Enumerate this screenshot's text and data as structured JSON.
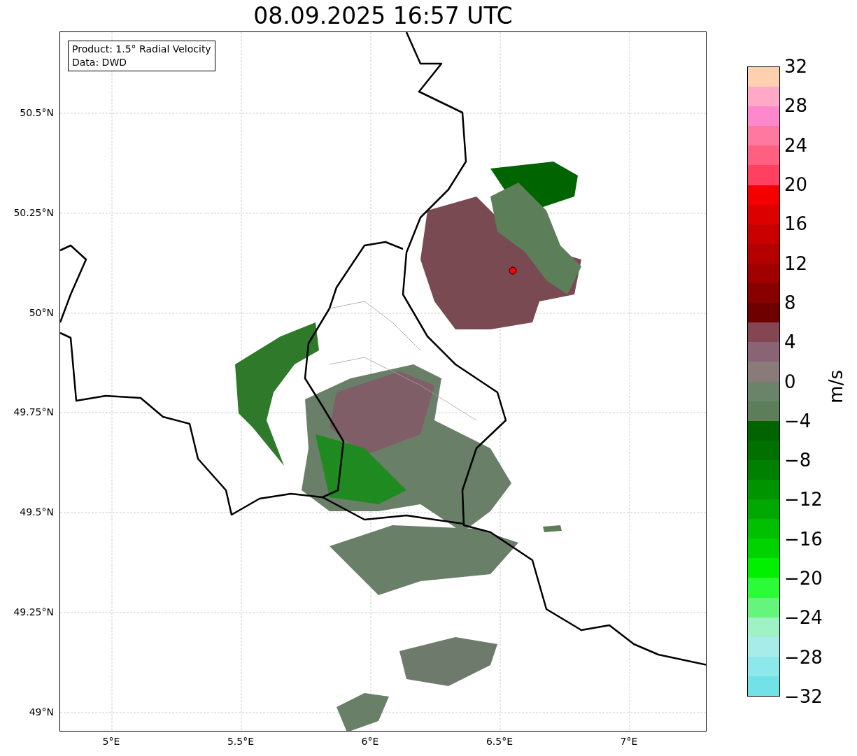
{
  "title": "08.09.2025 16:57 UTC",
  "legend": [
    "Product: 1.5° Radial Velocity",
    "Data: DWD"
  ],
  "map": {
    "y_ticks": [
      "50.5°N",
      "50.25°N",
      "50°N",
      "49.75°N",
      "49.5°N",
      "49.25°N",
      "49°N"
    ],
    "x_ticks": [
      "5°E",
      "5.5°E",
      "6°E",
      "6.5°E",
      "7°E"
    ]
  },
  "colorbar": {
    "label": "m/s",
    "ticks": [
      "32",
      "28",
      "24",
      "20",
      "16",
      "12",
      "8",
      "4",
      "0",
      "−4",
      "−8",
      "−12",
      "−16",
      "−20",
      "−24",
      "−28",
      "−32"
    ],
    "segments": [
      {
        "color": "#72e2e6"
      },
      {
        "color": "#8ce8ea"
      },
      {
        "color": "#a8ecea"
      },
      {
        "color": "#9ef2c6"
      },
      {
        "color": "#66f57c"
      },
      {
        "color": "#2cfc38"
      },
      {
        "color": "#00f000"
      },
      {
        "color": "#00d400"
      },
      {
        "color": "#00c000"
      },
      {
        "color": "#00a800"
      },
      {
        "color": "#009400"
      },
      {
        "color": "#008000"
      },
      {
        "color": "#007000"
      },
      {
        "color": "#006400"
      },
      {
        "color": "#5c7e58"
      },
      {
        "color": "#6a846a"
      },
      {
        "color": "#8a7a7a"
      },
      {
        "color": "#8a6474"
      },
      {
        "color": "#844650"
      },
      {
        "color": "#6e0000"
      },
      {
        "color": "#880000"
      },
      {
        "color": "#a00000"
      },
      {
        "color": "#b40000"
      },
      {
        "color": "#c80000"
      },
      {
        "color": "#dc0000"
      },
      {
        "color": "#f40000"
      },
      {
        "color": "#ff4060"
      },
      {
        "color": "#ff6080"
      },
      {
        "color": "#ff78a0"
      },
      {
        "color": "#ff88cc"
      },
      {
        "color": "#ffa8c8"
      },
      {
        "color": "#ffd0b0"
      }
    ]
  }
}
